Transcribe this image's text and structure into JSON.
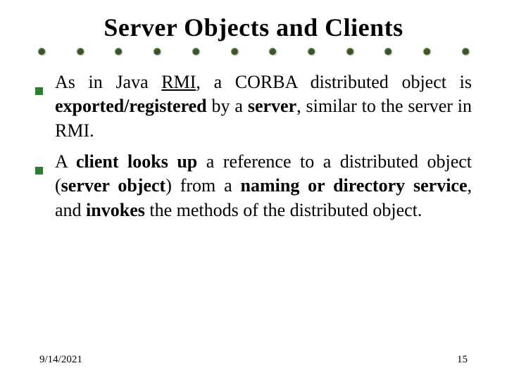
{
  "title": "Server Objects and Clients",
  "bullets": [
    {
      "segments": [
        {
          "t": "As in Java ",
          "b": false,
          "u": false
        },
        {
          "t": "RMI",
          "b": false,
          "u": true
        },
        {
          "t": ", a CORBA distributed object is ",
          "b": false,
          "u": false
        },
        {
          "t": "exported/registered",
          "b": true,
          "u": false
        },
        {
          "t": " by a ",
          "b": false,
          "u": false
        },
        {
          "t": "server",
          "b": true,
          "u": false
        },
        {
          "t": ", similar to the server in RMI.",
          "b": false,
          "u": false
        }
      ]
    },
    {
      "segments": [
        {
          "t": "A ",
          "b": false,
          "u": false
        },
        {
          "t": "client looks up",
          "b": true,
          "u": false
        },
        {
          "t": " a reference to a distributed object (",
          "b": false,
          "u": false
        },
        {
          "t": "server object",
          "b": true,
          "u": false
        },
        {
          "t": ") from a ",
          "b": false,
          "u": false
        },
        {
          "t": "naming or directory service",
          "b": true,
          "u": false
        },
        {
          "t": ", and ",
          "b": false,
          "u": false
        },
        {
          "t": "invokes",
          "b": true,
          "u": false
        },
        {
          "t": " the methods of the distributed object.",
          "b": false,
          "u": false
        }
      ]
    }
  ],
  "footer": {
    "date": "9/14/2021",
    "page": "15"
  },
  "dot_count": 12
}
